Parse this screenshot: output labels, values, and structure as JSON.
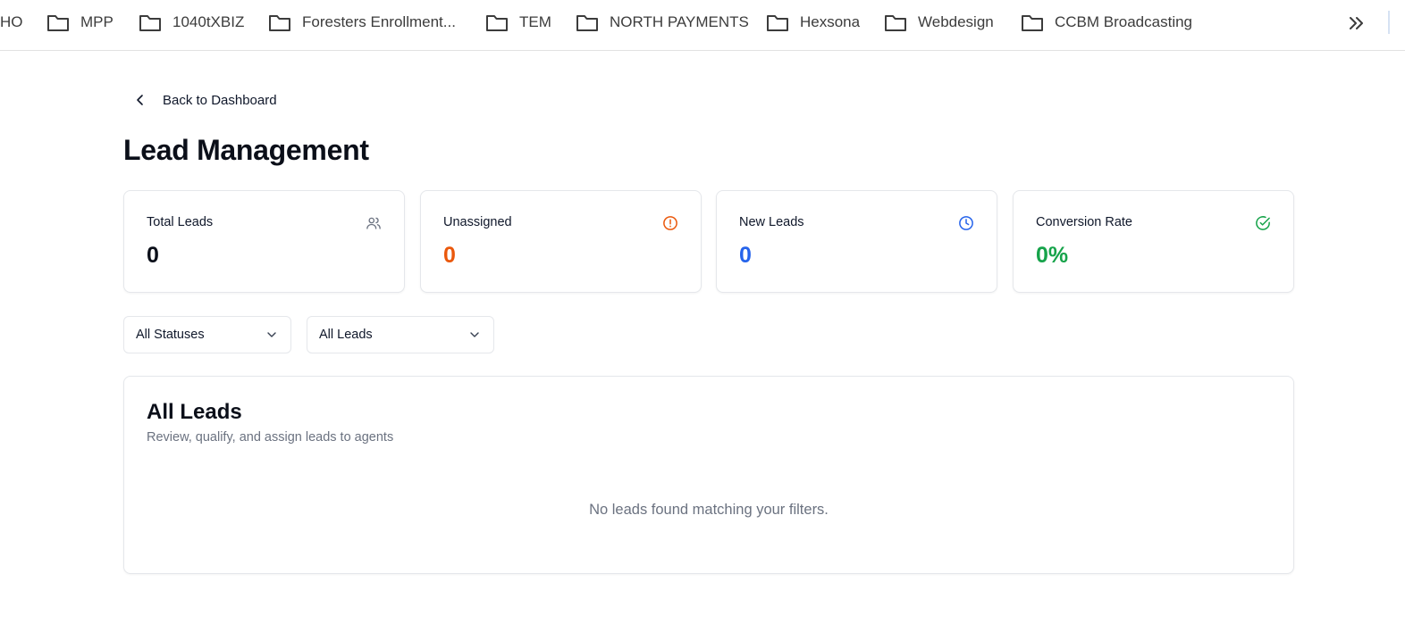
{
  "bookmarks": {
    "partial_label": "HO",
    "items": [
      {
        "label": "MPP"
      },
      {
        "label": "1040tXBIZ"
      },
      {
        "label": "Foresters Enrollment..."
      },
      {
        "label": "TEM"
      },
      {
        "label": "NORTH PAYMENTS"
      },
      {
        "label": "Hexsona"
      },
      {
        "label": "Webdesign"
      },
      {
        "label": "CCBM Broadcasting"
      }
    ],
    "overflow_icon": "double-chevron-right-icon"
  },
  "page": {
    "back_label": "Back to Dashboard",
    "title": "Lead Management"
  },
  "stats": [
    {
      "label": "Total Leads",
      "value": "0",
      "icon": "users-icon",
      "color": "#0b0f19"
    },
    {
      "label": "Unassigned",
      "value": "0",
      "icon": "alert-circle-icon",
      "color": "#ea580c"
    },
    {
      "label": "New Leads",
      "value": "0",
      "icon": "clock-icon",
      "color": "#2563eb"
    },
    {
      "label": "Conversion Rate",
      "value": "0%",
      "icon": "check-circle-icon",
      "color": "#16a34a"
    }
  ],
  "filters": {
    "status": {
      "selected": "All Statuses"
    },
    "leads": {
      "selected": "All Leads"
    }
  },
  "leads_panel": {
    "title": "All Leads",
    "subtitle": "Review, qualify, and assign leads to agents",
    "empty_message": "No leads found matching your filters."
  }
}
